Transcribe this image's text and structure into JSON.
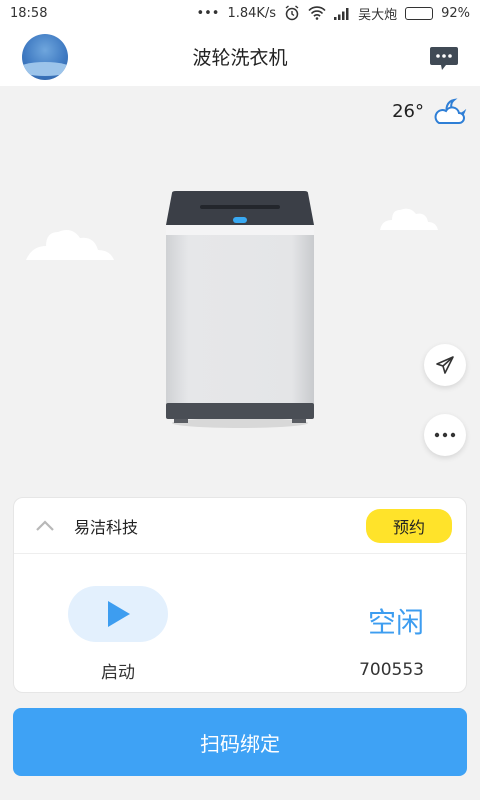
{
  "status_bar": {
    "time": "18:58",
    "dots": "•••",
    "net_speed": "1.84K/s",
    "carrier": "吴大炮",
    "battery": "92%",
    "battery_level": 0.92
  },
  "header": {
    "title": "波轮洗衣机"
  },
  "weather": {
    "temperature": "26°"
  },
  "card": {
    "brand": "易洁科技",
    "reserve_label": "预约",
    "start_label": "启动",
    "machine_status": "空闲",
    "machine_id": "700553"
  },
  "bind_button": {
    "label": "扫码绑定"
  },
  "colors": {
    "accent_blue": "#3ea2f5",
    "status_blue": "#3d9df0",
    "reserve_yellow": "#ffe32a",
    "background": "#f2f2f2"
  },
  "icons": [
    "alarm-icon",
    "wifi-icon",
    "signal-icon",
    "battery-icon",
    "avatar",
    "message-icon",
    "weather-cloud-moon-icon",
    "send-icon",
    "more-icon",
    "chevron-up-icon",
    "play-icon"
  ]
}
